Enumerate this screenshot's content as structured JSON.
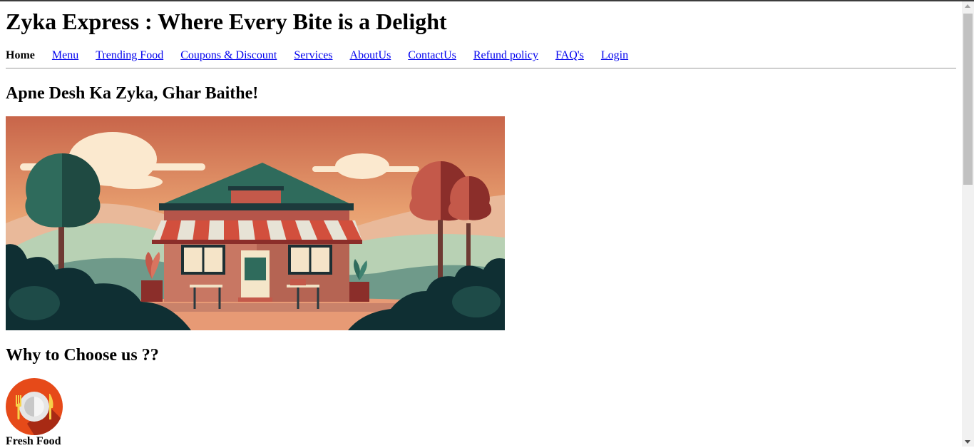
{
  "site": {
    "title": "Zyka Express : Where Every Bite is a Delight"
  },
  "nav": {
    "home": "Home",
    "menu": "Menu",
    "trending": "Trending Food",
    "coupons": "Coupons & Discount",
    "services": "Services",
    "about": "AboutUs",
    "contact": "ContactUs",
    "refund": "Refund policy",
    "faq": "FAQ's",
    "login": "Login"
  },
  "hero": {
    "tagline": "Apne Desh Ka Zyka, Ghar Baithe!",
    "image_icon": "restaurant-illustration"
  },
  "why": {
    "heading": "Why to Choose us ??",
    "features": [
      {
        "label": "Fresh Food",
        "icon": "plate-fork-knife-icon"
      }
    ]
  },
  "colors": {
    "link": "#0000ee",
    "hero_sky_top": "#c8654a",
    "hero_sky_bottom": "#f3d3a6",
    "icon_bg": "#e64a19"
  }
}
